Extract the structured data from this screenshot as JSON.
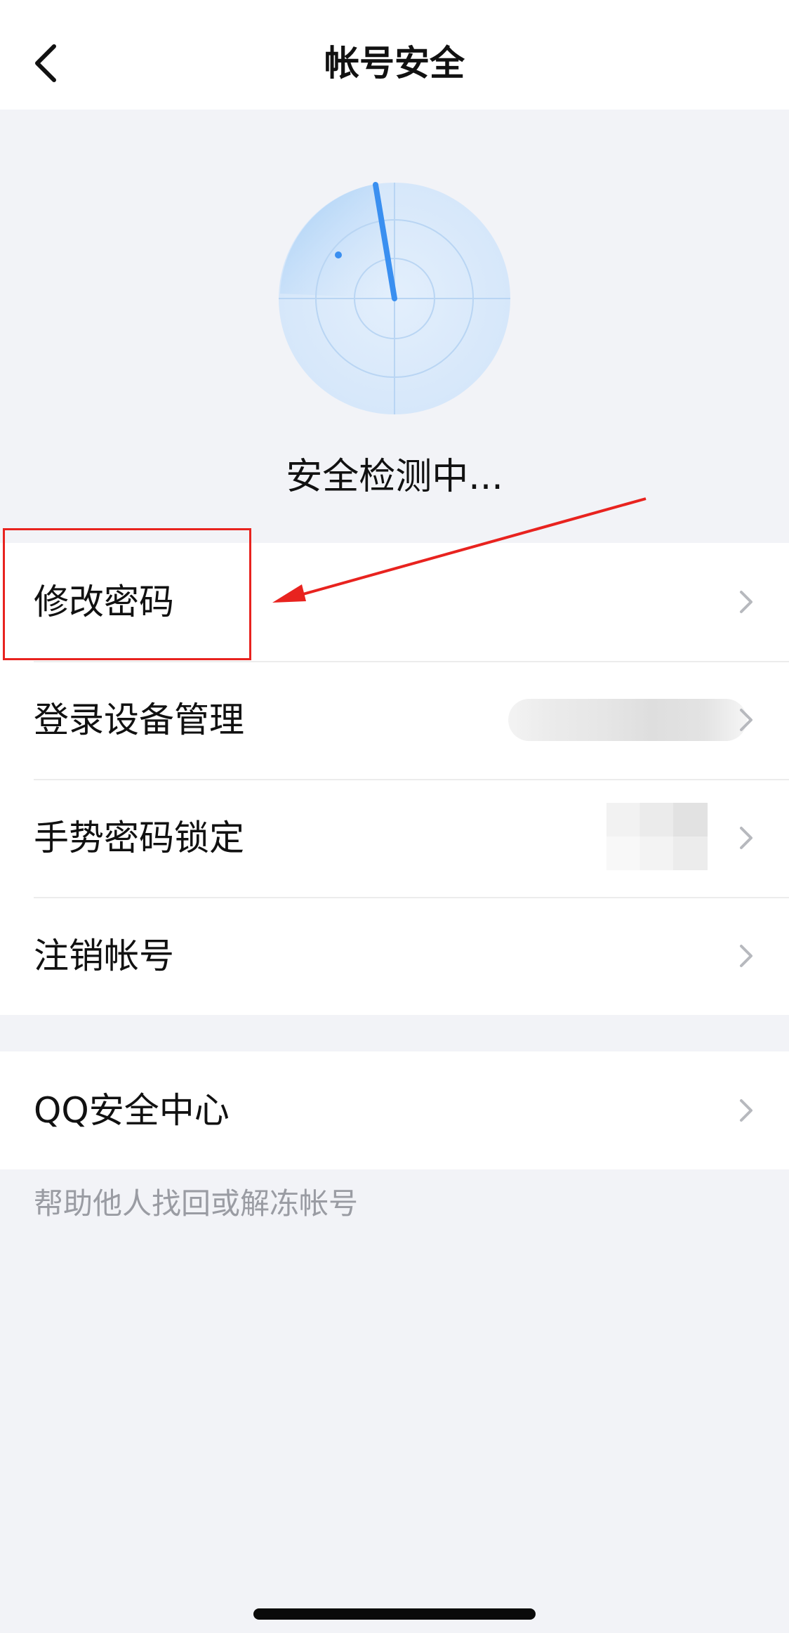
{
  "header": {
    "title": "帐号安全",
    "back_icon": "chevron-left-icon"
  },
  "security_scan": {
    "status": "安全检测中...",
    "radar_icon": "radar-scan-icon",
    "colors": {
      "ring_fill": "#d8e9fb",
      "sweep": "#3a8ff0"
    }
  },
  "groups": [
    {
      "items": [
        {
          "label": "修改密码",
          "chevron_icon": "chevron-right-icon"
        },
        {
          "label": "登录设备管理",
          "chevron_icon": "chevron-right-icon"
        },
        {
          "label": "手势密码锁定",
          "chevron_icon": "chevron-right-icon"
        },
        {
          "label": "注销帐号",
          "chevron_icon": "chevron-right-icon"
        }
      ]
    },
    {
      "items": [
        {
          "label": "QQ安全中心",
          "chevron_icon": "chevron-right-icon"
        }
      ]
    }
  ],
  "footer_note": "帮助他人找回或解冻帐号",
  "annotation": {
    "color": "#e8231f"
  }
}
